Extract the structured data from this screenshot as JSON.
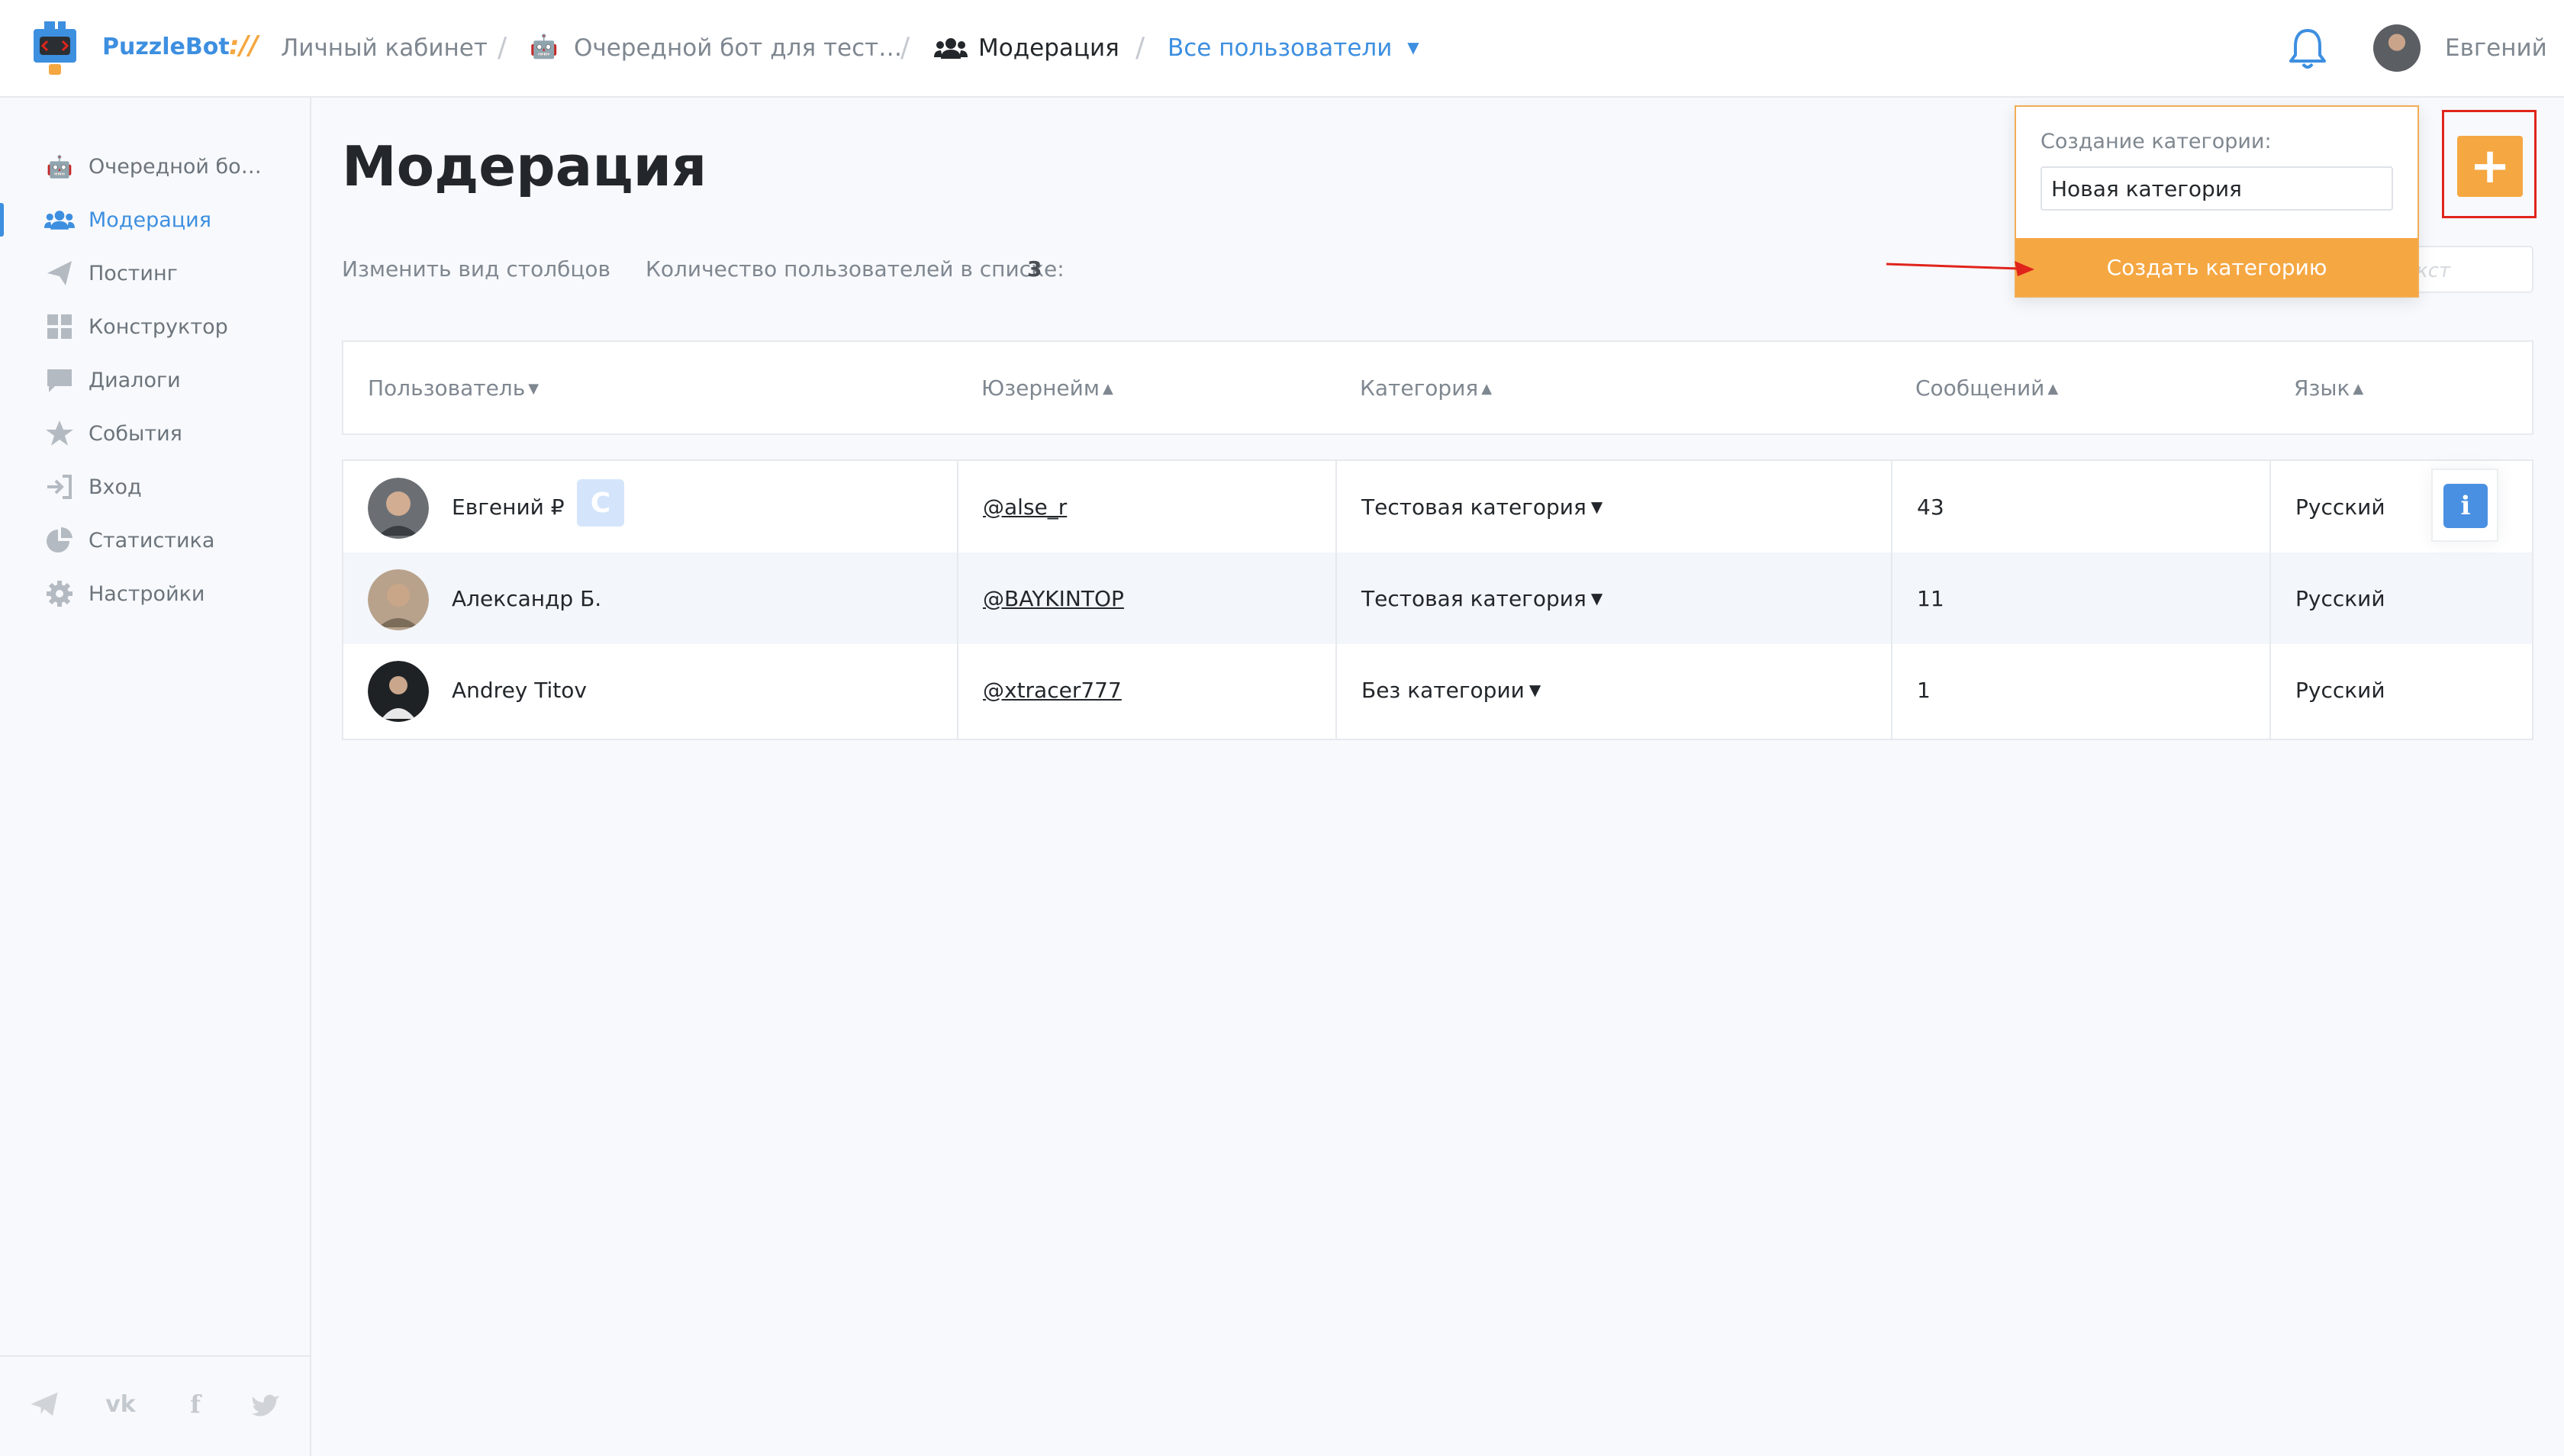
{
  "topbar": {
    "brand": "PuzzleBot",
    "brand_slashes": "://",
    "crumbs": {
      "cabinet": "Личный кабинет",
      "bot": "Очередной бот для тест…",
      "moderation": "Модерация",
      "users_filter": "Все пользователи"
    },
    "user_name": "Евгений"
  },
  "sidebar": {
    "items": [
      {
        "label": "Очередной бо…",
        "icon": "bot-icon"
      },
      {
        "label": "Модерация",
        "icon": "users-icon"
      },
      {
        "label": "Постинг",
        "icon": "paper-plane-icon"
      },
      {
        "label": "Конструктор",
        "icon": "grid-icon"
      },
      {
        "label": "Диалоги",
        "icon": "chat-icon"
      },
      {
        "label": "События",
        "icon": "star-icon"
      },
      {
        "label": "Вход",
        "icon": "sign-in-icon"
      },
      {
        "label": "Статистика",
        "icon": "pie-chart-icon"
      },
      {
        "label": "Настройки",
        "icon": "gear-icon"
      }
    ],
    "social_icons": [
      "telegram-icon",
      "vk-icon",
      "facebook-icon",
      "twitter-icon"
    ]
  },
  "main": {
    "title": "Модерация",
    "columns_link": "Изменить вид столбцов",
    "count_label": "Количество пользователей в списке:",
    "count_value": "3",
    "search_placeholder": "кст"
  },
  "table": {
    "headers": [
      "Пользователь",
      "Юзернейм",
      "Категория",
      "Сообщений",
      "Язык"
    ],
    "rows": [
      {
        "name": "Евгений ₽",
        "badge": "C",
        "username": "@alse_r",
        "category": "Тестовая категория",
        "messages": "43",
        "language": "Русский"
      },
      {
        "name": "Александр Б.",
        "username": "@BAYKINTOP",
        "category": "Тестовая категория",
        "messages": "11",
        "language": "Русский"
      },
      {
        "name": "Andrey Titov",
        "username": "@xtracer777",
        "category": "Без категории",
        "messages": "1",
        "language": "Русский"
      }
    ]
  },
  "popover": {
    "title": "Создание категории:",
    "input_value": "Новая категория",
    "button_label": "Создать категорию"
  },
  "colors": {
    "accent_blue": "#3d8fe0",
    "accent_orange": "#f5a742",
    "highlight_red": "#e0241c"
  }
}
